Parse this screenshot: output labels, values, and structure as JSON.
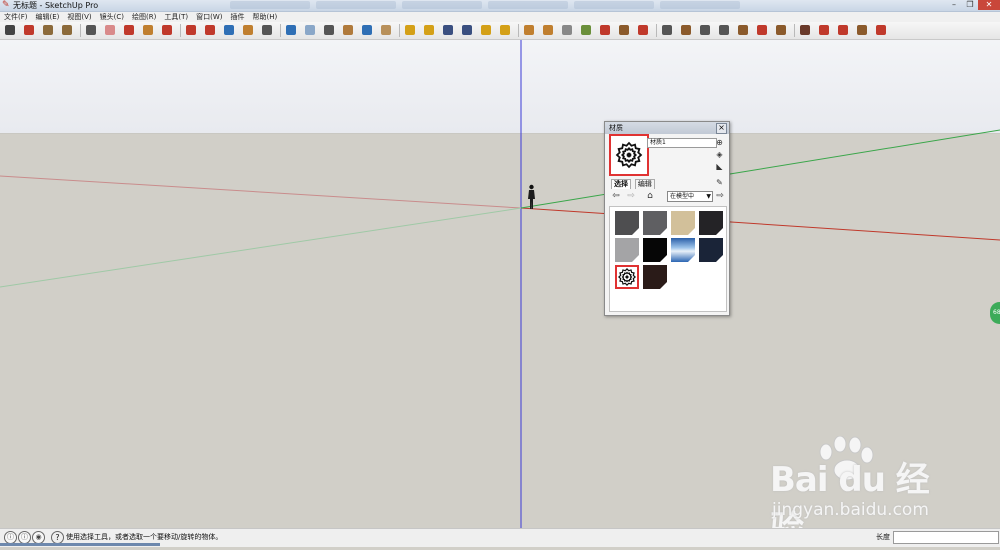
{
  "window": {
    "title": "无标题 - SketchUp Pro",
    "buttons": [
      "–",
      "❐",
      "✕"
    ]
  },
  "menubar": {
    "items": [
      "文件(F)",
      "编辑(E)",
      "视图(V)",
      "镜头(C)",
      "绘图(R)",
      "工具(T)",
      "窗口(W)",
      "插件",
      "帮助(H)"
    ]
  },
  "toolbar": {
    "colors": [
      "#444444",
      "#c0392b",
      "#8c6a3a",
      "#8c6a3a",
      "#555555",
      "#d98a8a",
      "#c0392b",
      "#c07f2f",
      "#c0392b",
      "#c0392b",
      "#c0392b",
      "#2f6fb5",
      "#c07f2f",
      "#555555",
      "#2f6fb5",
      "#8aa7c8",
      "#555555",
      "#b07a3b",
      "#2f6fb5",
      "#b8905a",
      "#d4a017",
      "#d4a017",
      "#3a4f80",
      "#3a4f80",
      "#d4a017",
      "#d4a017",
      "#c07f2f",
      "#c07f2f",
      "#888888",
      "#6a8f3a",
      "#c0392b",
      "#8b5a2b",
      "#c0392b",
      "#555555",
      "#8b5a2b",
      "#555555",
      "#555555",
      "#8b5a2b",
      "#c0392b",
      "#8b5a2b",
      "#6a3a2a",
      "#c0392b",
      "#c0392b",
      "#8b5a2b",
      "#c0392b"
    ]
  },
  "materials_panel": {
    "title": "材质",
    "close": "×",
    "material_name": "材质1",
    "tabs": [
      "选择",
      "编辑"
    ],
    "collection": "在模型中",
    "swatch_colors": [
      "#4e4e50",
      "#5f5f62",
      "#d2c09a",
      "#242326",
      "#a4a4a6",
      "#060606",
      "pool",
      "#1a2438",
      "pattern",
      "#2a1b18"
    ],
    "selected_swatch": 8
  },
  "statusbar": {
    "message": "使用选择工具，或者选取一个要移动/旋转的物体。",
    "value_label": "长度",
    "value": ""
  },
  "watermark": {
    "brand": "Bai du 经验",
    "url": "jingyan.baidu.com"
  },
  "edge_badge": "68"
}
